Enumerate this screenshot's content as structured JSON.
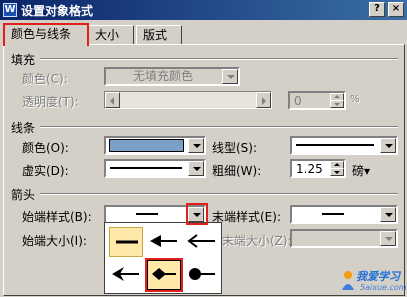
{
  "window": {
    "title": "设置对象格式",
    "app_icon": "W"
  },
  "tabs": [
    {
      "label": "颜色与线条",
      "active": true
    },
    {
      "label": "大小",
      "active": false
    },
    {
      "label": "版式",
      "active": false
    }
  ],
  "fill": {
    "section": "填充",
    "color_label": "颜色(C):",
    "color_value": "无填充颜色",
    "transparency_label": "透明度(T):",
    "transparency_value": "0",
    "transparency_unit": "%"
  },
  "line": {
    "section": "线条",
    "color_label": "颜色(O):",
    "color_value": "#7b9fc6",
    "style_label": "线型(S):",
    "dash_label": "虚实(D):",
    "weight_label": "粗细(W):",
    "weight_value": "1.25",
    "weight_unit": "磅▾"
  },
  "arrows": {
    "section": "箭头",
    "begin_style_label": "始端样式(B):",
    "end_style_label": "末端样式(E):",
    "begin_size_label": "始端大小(I):",
    "end_size_label": "末端大小(Z):",
    "popup_options": [
      "no-arrow",
      "arrow-filled",
      "arrow-open",
      "arrow-stealth",
      "arrow-diamond",
      "arrow-oval"
    ],
    "selected_option": "arrow-diamond"
  },
  "watermark": {
    "text": "我爱学习",
    "sub": "5aixue.com"
  },
  "colors": {
    "dialog_bg": "#d4d0c8",
    "highlight": "#e0201c",
    "title_bar": "#0a246a"
  }
}
